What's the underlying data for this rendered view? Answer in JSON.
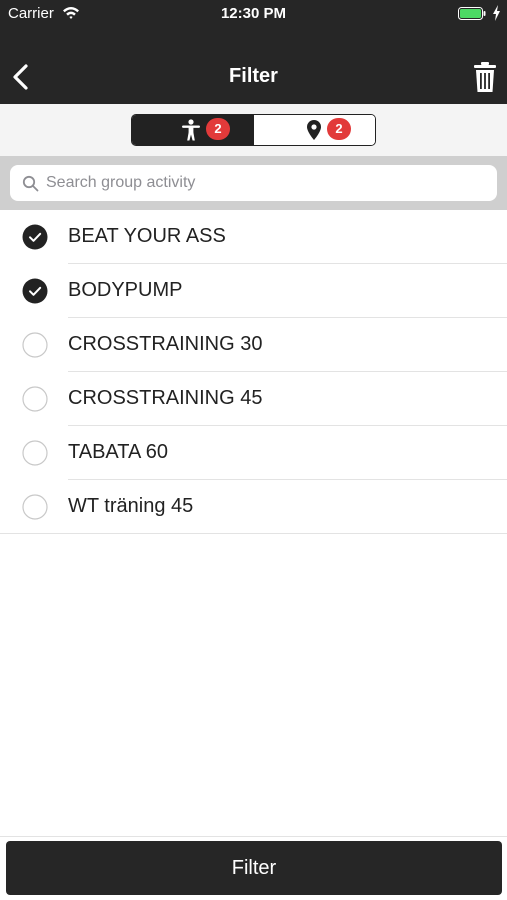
{
  "status_bar": {
    "carrier": "Carrier",
    "time": "12:30 PM",
    "battery_color": "#4cd964"
  },
  "nav": {
    "title": "Filter",
    "back_icon": "chevron-left-icon",
    "trash_icon": "trash-icon"
  },
  "segments": [
    {
      "icon": "person-icon",
      "badge": "2",
      "selected": true
    },
    {
      "icon": "location-pin-icon",
      "badge": "2",
      "selected": false
    }
  ],
  "search": {
    "placeholder": "Search group activity",
    "value": ""
  },
  "activities": [
    {
      "label": "BEAT YOUR ASS",
      "checked": true
    },
    {
      "label": "BODYPUMP",
      "checked": true
    },
    {
      "label": "CROSSTRAINING 30",
      "checked": false
    },
    {
      "label": "CROSSTRAINING 45",
      "checked": false
    },
    {
      "label": "TABATA 60",
      "checked": false
    },
    {
      "label": "WT träning 45",
      "checked": false
    }
  ],
  "footer": {
    "filter_label": "Filter"
  },
  "colors": {
    "bar": "#262626",
    "badge": "#e23a3a",
    "check": "#222222"
  }
}
